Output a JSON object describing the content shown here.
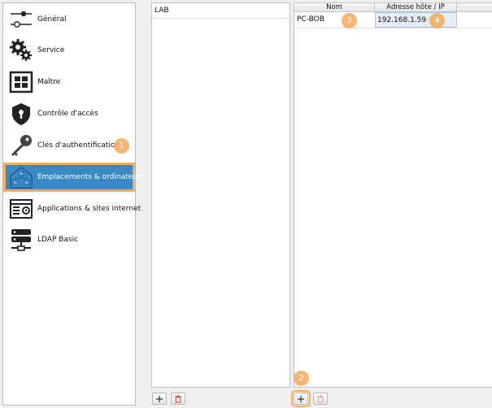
{
  "sidebar": {
    "items": [
      {
        "label": "Général",
        "icon": "sliders-icon"
      },
      {
        "label": "Service",
        "icon": "gears-icon"
      },
      {
        "label": "Maître",
        "icon": "grid-window-icon"
      },
      {
        "label": "Contrôle d'accès",
        "icon": "lock-shield-icon"
      },
      {
        "label": "Clés d'authentification",
        "icon": "key-icon"
      },
      {
        "label": "Emplacements & ordinateurs",
        "icon": "network-locations-icon",
        "selected": true
      },
      {
        "label": "Applications & sites internet",
        "icon": "application-window-icon"
      },
      {
        "label": "LDAP Basic",
        "icon": "ldap-server-icon"
      }
    ]
  },
  "locations": {
    "items": [
      "LAB"
    ]
  },
  "computers": {
    "columns": [
      "Nom",
      "Adresse hôte / IP"
    ],
    "rows": [
      {
        "name": "PC-BOB",
        "host": "192.168.1.59"
      }
    ]
  },
  "annotations": {
    "step1": "1",
    "step2": "2",
    "step3": "3",
    "step4": "4"
  },
  "colors": {
    "selection": "#3a88c6",
    "highlight": "#f4ae5a",
    "badge": "#f5b065",
    "delete": "#d23b3b"
  }
}
